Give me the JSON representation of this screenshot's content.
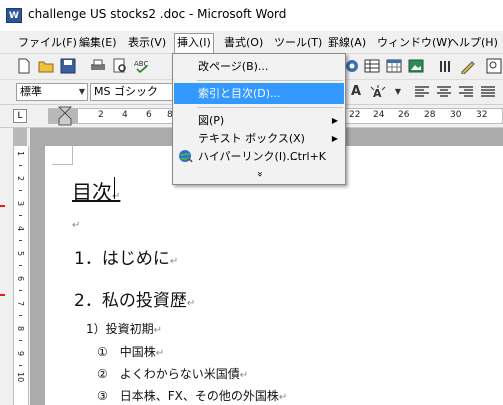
{
  "window": {
    "icon_label": "W",
    "title": "challenge US stocks2 .doc - Microsoft Word"
  },
  "menubar": {
    "items": [
      {
        "label": "ファイル(F)"
      },
      {
        "label": "編集(E)"
      },
      {
        "label": "表示(V)"
      },
      {
        "label": "挿入(I)"
      },
      {
        "label": "書式(O)"
      },
      {
        "label": "ツール(T)"
      },
      {
        "label": "罫線(A)"
      },
      {
        "label": "ウィンドウ(W)"
      },
      {
        "label": "ヘルプ(H)"
      }
    ]
  },
  "insert_menu": {
    "items": [
      {
        "label": "改ページ(B)...",
        "shortcut": "",
        "submenu": false
      },
      {
        "label": "索引と目次(D)...",
        "shortcut": "",
        "submenu": false
      },
      {
        "label": "図(P)",
        "shortcut": "",
        "submenu": true
      },
      {
        "label": "テキスト ボックス(X)",
        "shortcut": "",
        "submenu": true
      },
      {
        "label": "ハイパーリンク(I)...",
        "shortcut": "Ctrl+K",
        "submenu": false
      }
    ],
    "expand_glyph": "»"
  },
  "formatting": {
    "style": "標準",
    "font": "MS ゴシック"
  },
  "ruler": {
    "tab_glyph": "L",
    "numbers": [
      "2",
      "4",
      "6",
      "8",
      "22",
      "24",
      "26",
      "28",
      "30",
      "32"
    ],
    "vertical_numbers": [
      "1",
      "2",
      "3",
      "4",
      "5",
      "6",
      "7",
      "8",
      "9",
      "10"
    ]
  },
  "document": {
    "para_mark": "↵",
    "heading": "目次",
    "lines": [
      "1．はじめに",
      "2．私の投資歴",
      "1）投資初期",
      "①　中国株",
      "②　よくわからない米国債",
      "③　日本株、FX、その他の外国株"
    ]
  },
  "colors": {
    "highlight": "#3399ff",
    "menu_bg": "#f2f2f2",
    "doc_bg": "#ababab"
  }
}
